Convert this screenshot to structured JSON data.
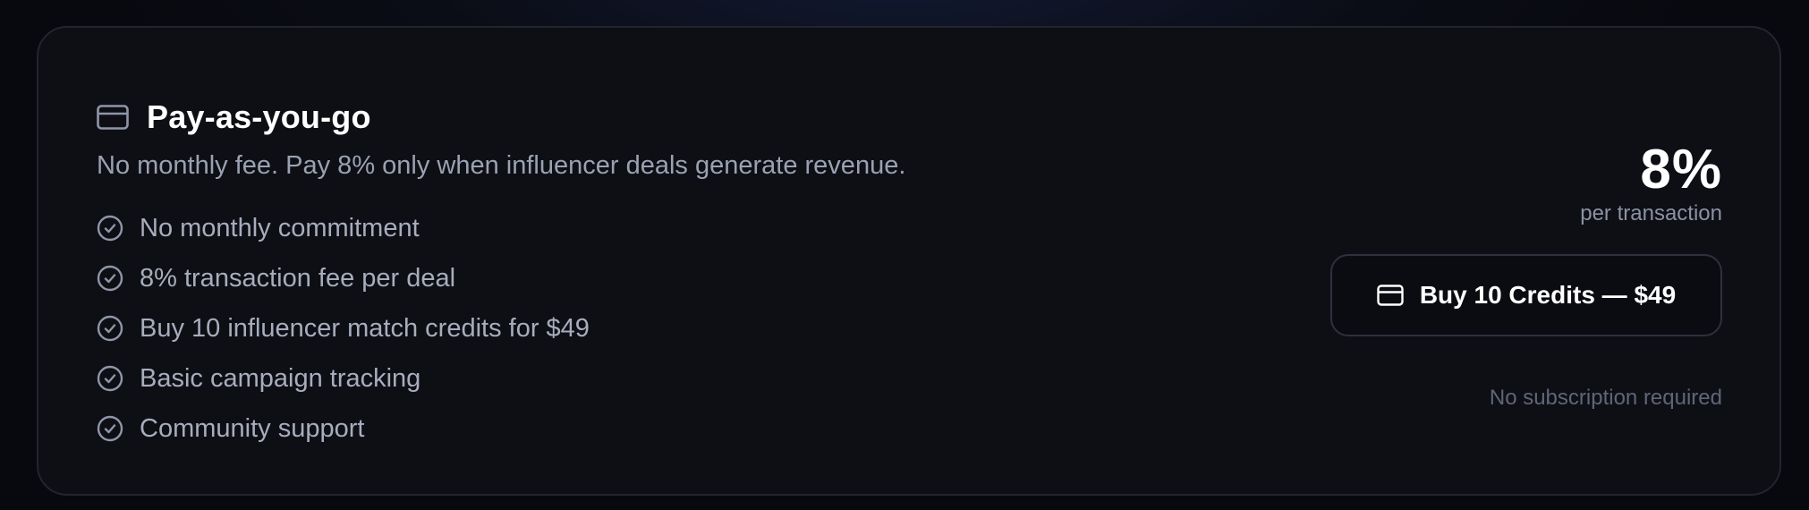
{
  "plan": {
    "icon": "credit-card-icon",
    "title": "Pay-as-you-go",
    "subtitle": "No monthly fee. Pay 8% only when influencer deals generate revenue.",
    "features": [
      {
        "icon": "check-circle-icon",
        "text": "No monthly commitment"
      },
      {
        "icon": "check-circle-icon",
        "text": "8% transaction fee per deal"
      },
      {
        "icon": "check-circle-icon",
        "text": "Buy 10 influencer match credits for $49"
      },
      {
        "icon": "check-circle-icon",
        "text": "Basic campaign tracking"
      },
      {
        "icon": "check-circle-icon",
        "text": "Community support"
      }
    ],
    "price": "8%",
    "price_caption": "per transaction",
    "button": {
      "icon": "credit-card-icon",
      "label": "Buy 10 Credits — $49"
    },
    "note": "No subscription required"
  },
  "colors": {
    "background": "#0b0d16",
    "card": "#0e0f15",
    "border": "#23252e",
    "title": "#ffffff",
    "muted_text": "#9aa1b2",
    "icon_stroke": "#8f96a8",
    "note_text": "#5f6678"
  }
}
